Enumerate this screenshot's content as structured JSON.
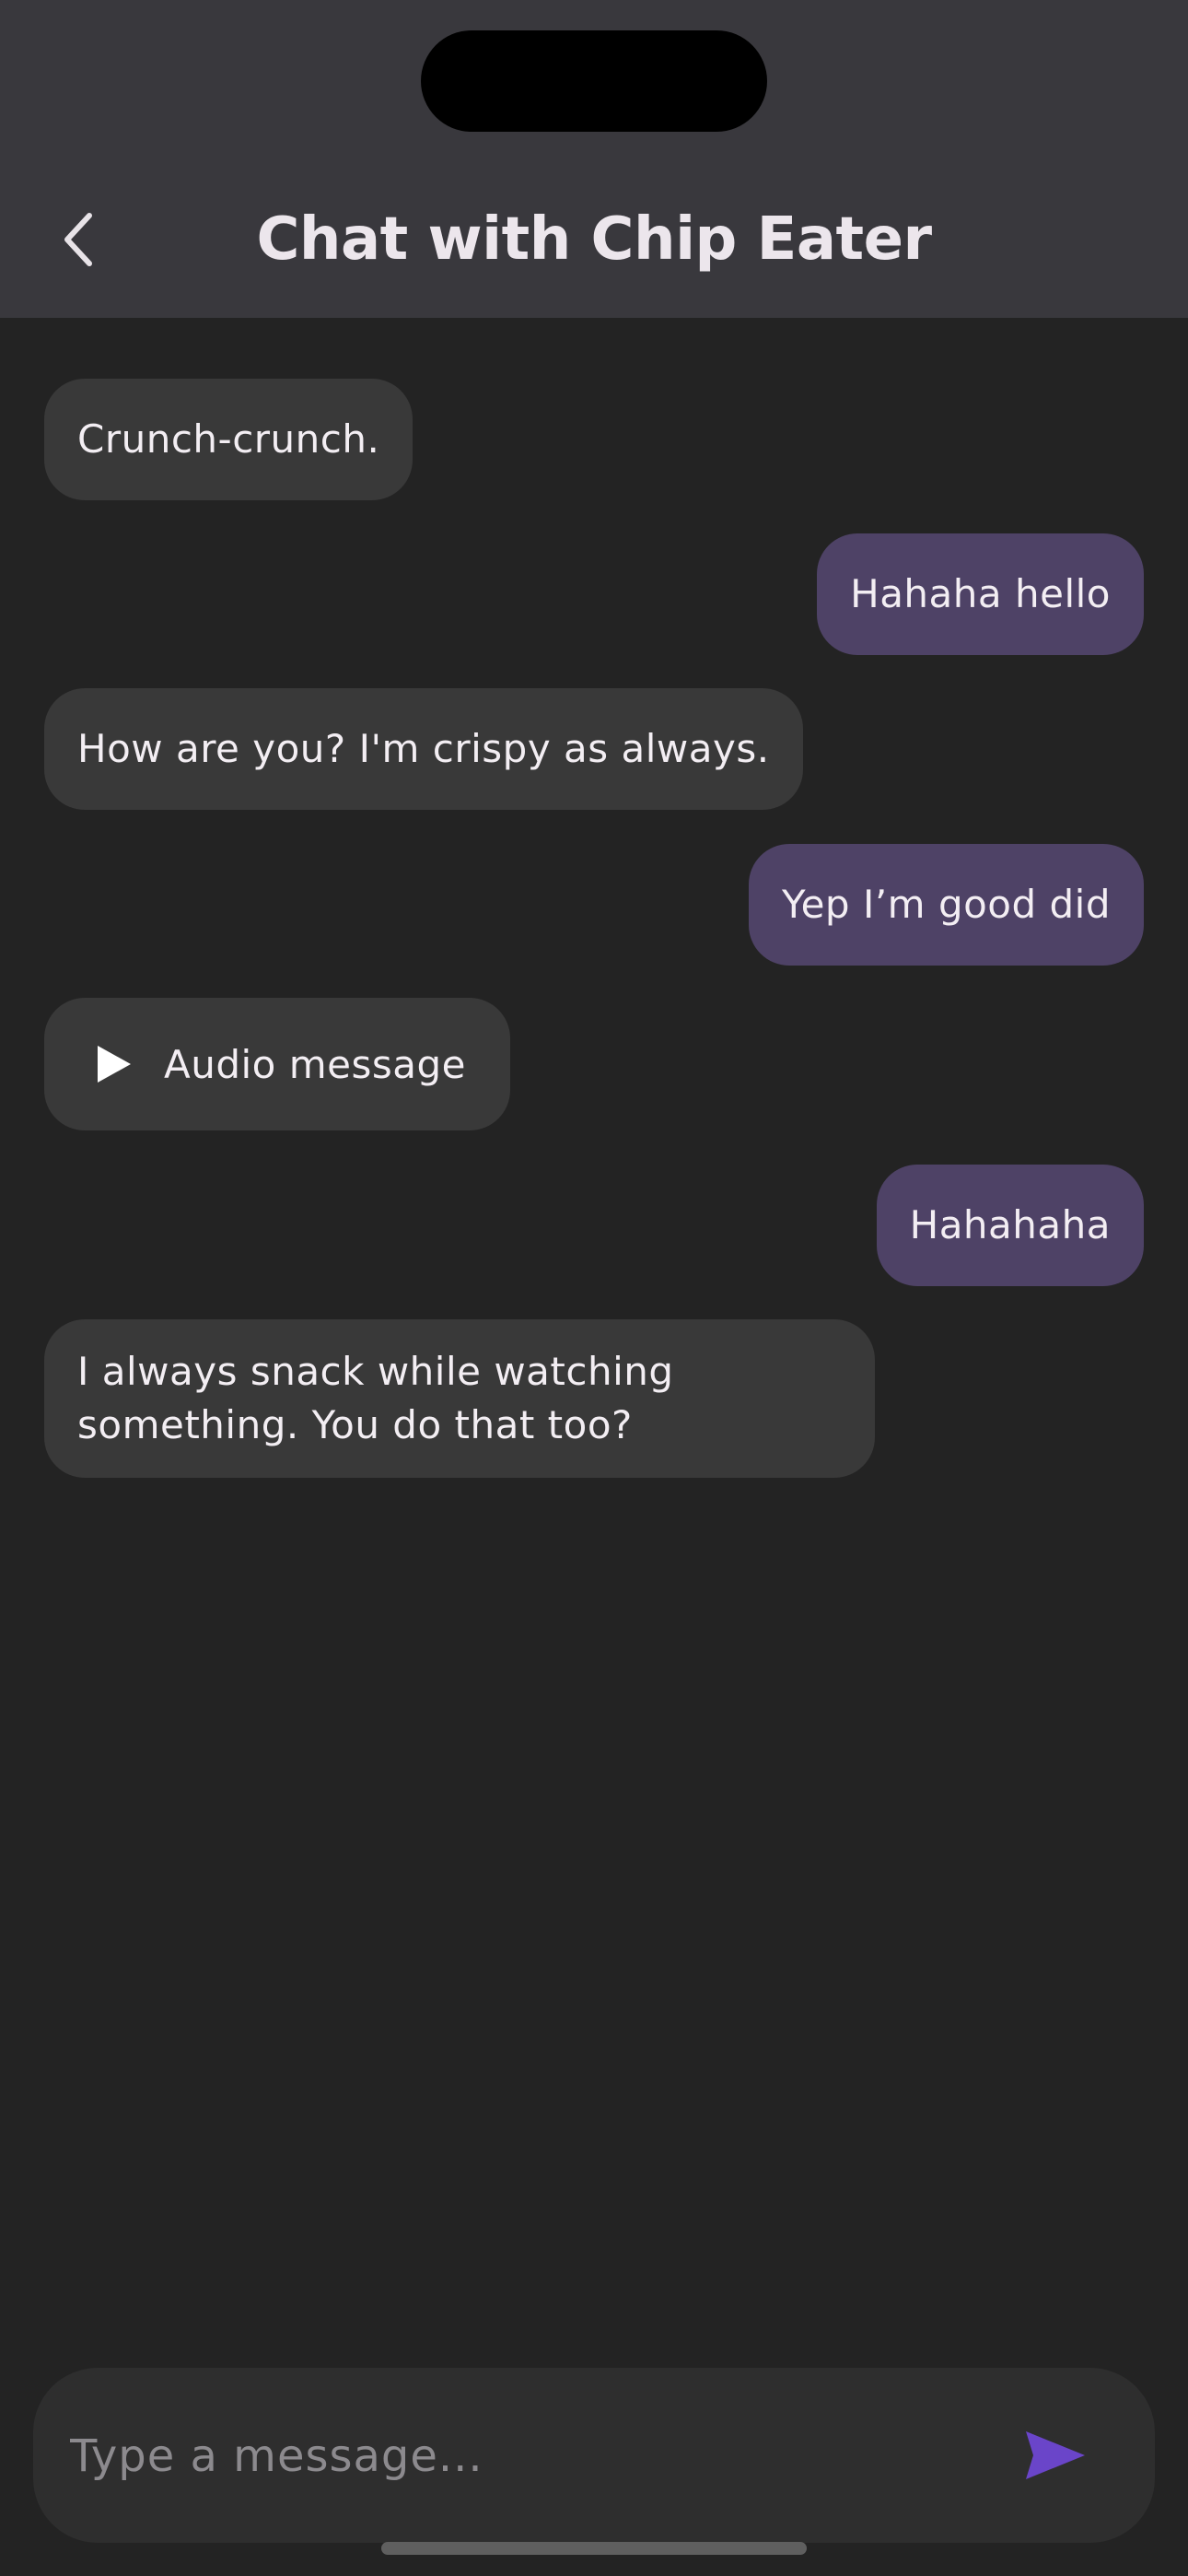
{
  "header": {
    "title": "Chat with Chip Eater"
  },
  "messages": [
    {
      "sender": "bot",
      "text": "Crunch-crunch."
    },
    {
      "sender": "user",
      "text": "Hahaha hello"
    },
    {
      "sender": "bot",
      "text": "How are you? I'm crispy as always."
    },
    {
      "sender": "user",
      "text": "Yep I’m good did"
    },
    {
      "sender": "bot",
      "type": "audio",
      "text": "Audio message"
    },
    {
      "sender": "user",
      "text": "Hahahaha"
    },
    {
      "sender": "bot",
      "text": "I always snack while watching something. You do that too?"
    }
  ],
  "composer": {
    "placeholder": "Type a message...",
    "value": ""
  },
  "icons": {
    "back": "chevron-left-icon",
    "play": "play-icon",
    "send": "send-icon"
  },
  "colors": {
    "background": "#232323",
    "header": "#39383d",
    "incoming_bubble": "#393939",
    "outgoing_bubble": "#4e4266",
    "send_accent": "#6a45c9"
  }
}
